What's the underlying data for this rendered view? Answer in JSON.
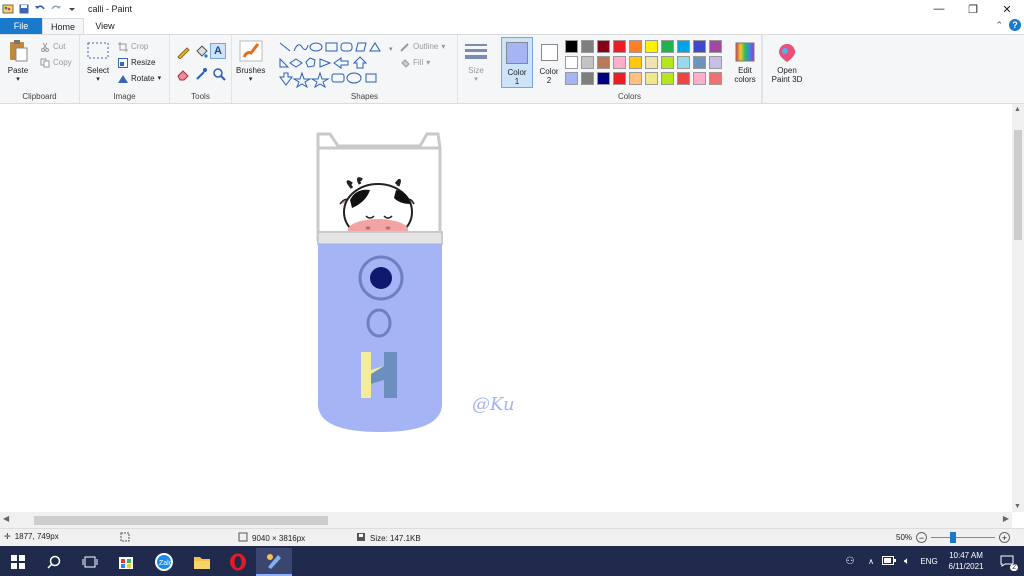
{
  "window": {
    "title": "calli - Paint",
    "minimize": "—",
    "maximize": "❐",
    "close": "✕"
  },
  "tabs": {
    "file": "File",
    "home": "Home",
    "view": "View",
    "collapse": "⌃",
    "help": "?"
  },
  "clipboard": {
    "paste": "Paste",
    "cut": "Cut",
    "copy": "Copy",
    "label": "Clipboard"
  },
  "image": {
    "select": "Select",
    "crop": "Crop",
    "resize": "Resize",
    "rotate": "Rotate",
    "label": "Image"
  },
  "tools": {
    "label": "Tools"
  },
  "brushes": {
    "label": "Brushes"
  },
  "shapes": {
    "outline": "Outline",
    "fill": "Fill",
    "label": "Shapes"
  },
  "size": {
    "label": "Size"
  },
  "colors": {
    "color1": "Color",
    "color1_num": "1",
    "color2": "Color",
    "color2_num": "2",
    "edit": "Edit",
    "edit2": "colors",
    "label": "Colors",
    "color1_value": "#a4b4f5",
    "color2_value": "#ffffff",
    "palette": [
      "#000000",
      "#7f7f7f",
      "#880015",
      "#ed1c24",
      "#ff7f27",
      "#fff200",
      "#22b14c",
      "#00a2e8",
      "#3f48cc",
      "#a349a4",
      "#ffffff",
      "#c3c3c3",
      "#b97a57",
      "#ffaec9",
      "#ffc90e",
      "#efe4b0",
      "#b5e61d",
      "#99d9ea",
      "#7092be",
      "#c8bfe7",
      "#a4b4f5",
      "#7f7f7f",
      "#000080",
      "#ed1c24",
      "#ffc080",
      "#f0e68c",
      "#b5e61d",
      "#ee4444",
      "#ffaec9",
      "#f07070"
    ]
  },
  "paint3d": {
    "line1": "Open",
    "line2": "Paint 3D"
  },
  "canvas": {
    "signature": "@Ku"
  },
  "status": {
    "cursor_pos": "1877, 749px",
    "image_size": "9040 × 3816px",
    "file_size": "Size: 147.1KB",
    "zoom": "50%",
    "zoom_level": 0.5
  },
  "taskbar": {
    "lang": "ENG",
    "time": "10:47 AM",
    "date": "6/11/2021",
    "notif_count": "2"
  }
}
